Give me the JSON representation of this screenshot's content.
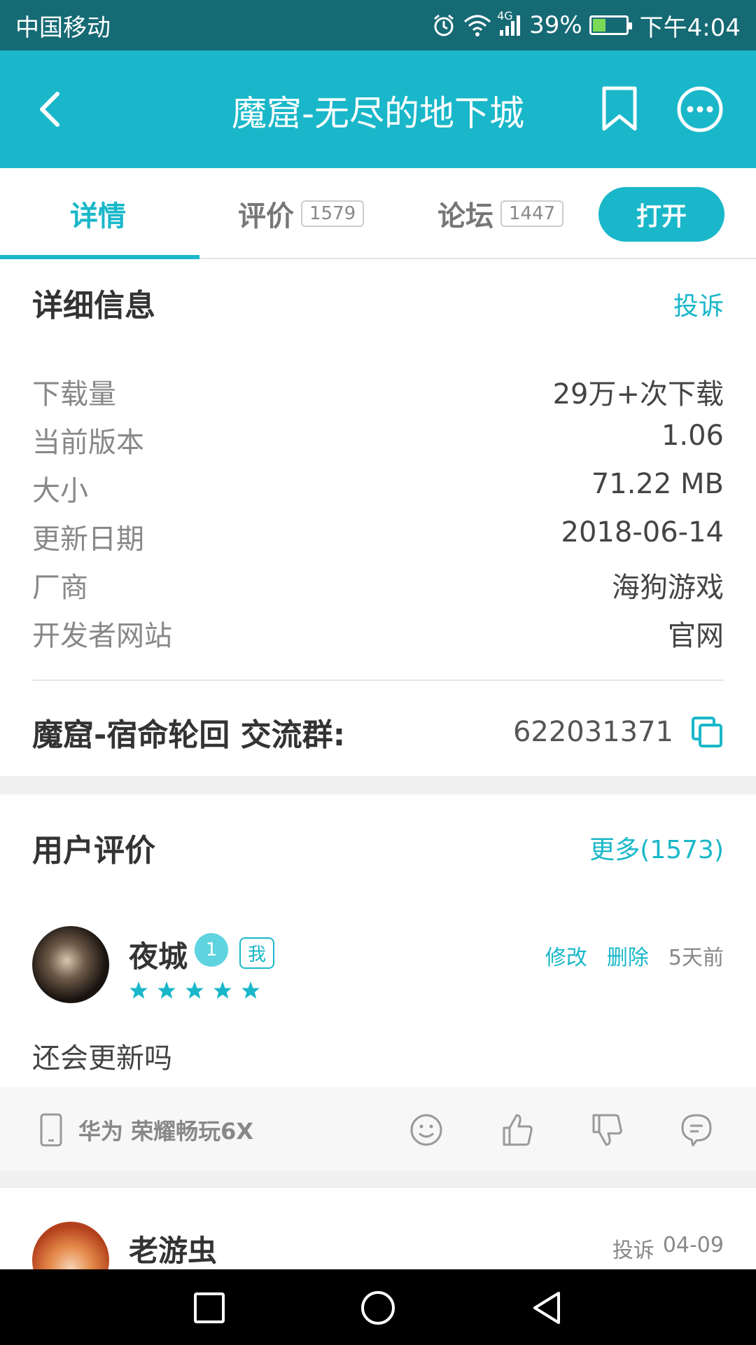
{
  "status_bar": {
    "carrier": "中国移动",
    "network": "4G",
    "battery": "39%",
    "battery_level": 0.39,
    "time": "下午4:04"
  },
  "header": {
    "title": "魔窟-无尽的地下城"
  },
  "tabs": [
    {
      "label": "详情",
      "count": ""
    },
    {
      "label": "评价",
      "count": "1579"
    },
    {
      "label": "论坛",
      "count": "1447"
    }
  ],
  "open_button": "打开",
  "details": {
    "title": "详细信息",
    "report": "投诉",
    "rows": [
      {
        "label": "下载量",
        "value": "29万+次下载"
      },
      {
        "label": "当前版本",
        "value": "1.06"
      },
      {
        "label": "大小",
        "value": "71.22 MB"
      },
      {
        "label": "更新日期",
        "value": "2018-06-14"
      },
      {
        "label": "厂商",
        "value": "海狗游戏"
      },
      {
        "label": "开发者网站",
        "value": "官网"
      }
    ]
  },
  "group": {
    "label": "魔窟-宿命轮回 交流群:",
    "number": "622031371"
  },
  "reviews_section": {
    "title": "用户评价",
    "more": "更多(1573)"
  },
  "reviews": [
    {
      "user": "夜城",
      "level": "1",
      "tag": "我",
      "rating": 5,
      "edit": "修改",
      "delete": "删除",
      "time": "5天前",
      "text": "还会更新吗",
      "device": "华为 荣耀畅玩6X"
    },
    {
      "user": "老游虫",
      "report": "投诉",
      "time": "04-09"
    }
  ],
  "colors": {
    "accent": "#19b7c9",
    "status_bar": "#156a74"
  }
}
